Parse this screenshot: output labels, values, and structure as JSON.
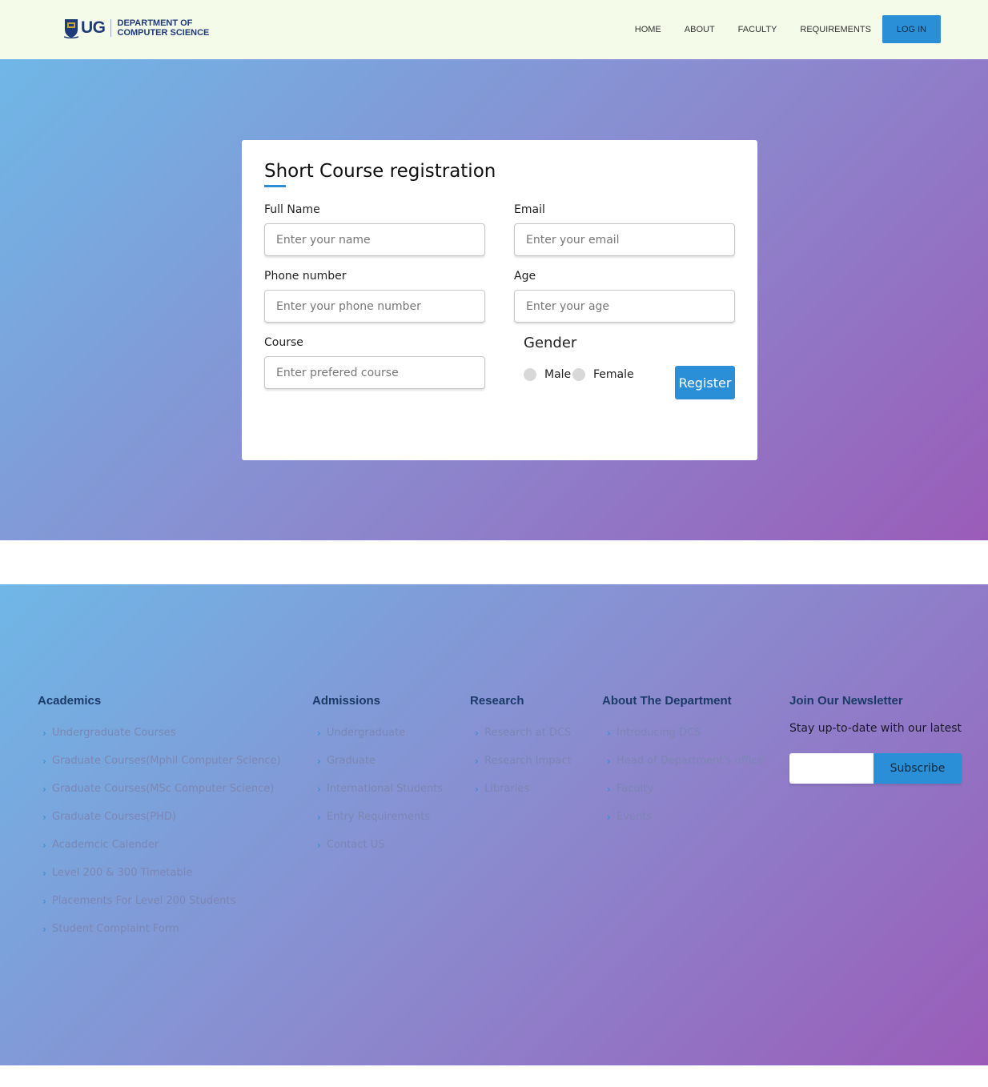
{
  "header": {
    "logo": {
      "ug": "UG",
      "line1": "DEPARTMENT OF",
      "line2": "COMPUTER SCIENCE",
      "crest_icon": "university-crest-icon"
    },
    "nav": [
      {
        "label": "HOME"
      },
      {
        "label": "ABOUT"
      },
      {
        "label": "FACULTY"
      },
      {
        "label": "REQUIREMENTS"
      }
    ],
    "login_label": "LOG IN"
  },
  "form": {
    "title": "Short Course registration",
    "full_name": {
      "label": "Full Name",
      "placeholder": "Enter your name",
      "value": ""
    },
    "email": {
      "label": "Email",
      "placeholder": "Enter your email",
      "value": ""
    },
    "phone": {
      "label": "Phone number",
      "placeholder": "Enter your phone number",
      "value": ""
    },
    "age": {
      "label": "Age",
      "placeholder": "Enter your age",
      "value": ""
    },
    "course": {
      "label": "Course",
      "placeholder": "Enter prefered course",
      "value": ""
    },
    "gender": {
      "title": "Gender",
      "options": [
        {
          "label": "Male",
          "checked": false
        },
        {
          "label": "Female",
          "checked": false
        }
      ]
    },
    "register_label": "Register"
  },
  "footer": {
    "academics": {
      "heading": "Academics",
      "items": [
        "Undergraduate Courses",
        "Graduate Courses(Mphil Computer Science)",
        "Graduate Courses(MSc Computer Science)",
        "Graduate Courses(PHD)",
        "Academcic Calender",
        "Level 200 & 300 Timetable",
        "Placements For Level 200 Students",
        "Student Complaint Form"
      ]
    },
    "admissions": {
      "heading": "Admissions",
      "items": [
        "Undergraduate",
        "Graduate",
        "International Students",
        "Entry Requirements",
        "Contact US"
      ]
    },
    "research": {
      "heading": "Research",
      "items": [
        "Research at DCS",
        "Research Impact",
        "Libraries"
      ]
    },
    "about": {
      "heading": "About The Department",
      "items": [
        "Introducing DCS",
        "Head of Department's office",
        "Faculty",
        "Events"
      ]
    },
    "newsletter": {
      "heading": "Join Our Newsletter",
      "text": "Stay up-to-date with our latest",
      "input_value": "",
      "subscribe_label": "Subscribe"
    },
    "chevron_icon": "chevron-right-icon"
  },
  "colors": {
    "accent": "#2a8fd6",
    "header_bg": "#f5fbe9",
    "gradient_start": "#6fb7e6",
    "gradient_end": "#9a5cb8",
    "footer_heading": "#1b3a66",
    "footer_link": "#7c86b3"
  }
}
